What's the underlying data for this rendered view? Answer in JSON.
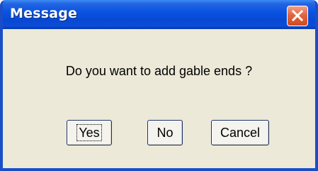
{
  "dialog": {
    "title": "Message",
    "message": "Do you want to add gable ends ?",
    "buttons": {
      "yes": "Yes",
      "no": "No",
      "cancel": "Cancel"
    },
    "close_icon": "close-icon"
  },
  "colors": {
    "titlebar": "#0a53e1",
    "window_border": "#1a4ec8",
    "dialog_background": "#ece9d8",
    "close_button": "#e2653f"
  }
}
